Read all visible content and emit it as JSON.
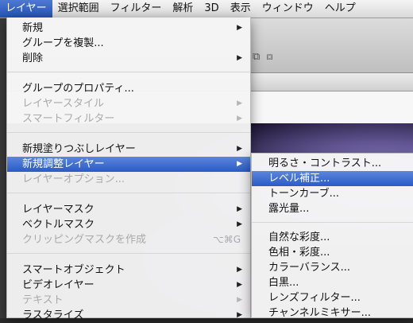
{
  "menubar": {
    "items": [
      "レイヤー",
      "選択範囲",
      "フィルター",
      "解析",
      "3D",
      "表示",
      "ウィンドウ",
      "ヘルプ"
    ]
  },
  "menu": {
    "items": [
      {
        "label": "新規",
        "arrow": "▶"
      },
      {
        "label": "グループを複製..."
      },
      {
        "label": "削除",
        "arrow": "▶"
      },
      {
        "label": "グループのプロパティ..."
      },
      {
        "label": "レイヤースタイル",
        "arrow": "▶",
        "disabled": true
      },
      {
        "label": "スマートフィルター",
        "arrow": "▶",
        "disabled": true
      },
      {
        "label": "新規塗りつぶしレイヤー",
        "arrow": "▶"
      },
      {
        "label": "新規調整レイヤー",
        "arrow": "▶",
        "highlight": true
      },
      {
        "label": "レイヤーオプション...",
        "disabled": true
      },
      {
        "label": "レイヤーマスク",
        "arrow": "▶"
      },
      {
        "label": "ベクトルマスク",
        "arrow": "▶"
      },
      {
        "label": "クリッピングマスクを作成",
        "shortcut": "⌥⌘G",
        "disabled": true
      },
      {
        "label": "スマートオブジェクト",
        "arrow": "▶"
      },
      {
        "label": "ビデオレイヤー",
        "arrow": "▶"
      },
      {
        "label": "テキスト",
        "arrow": "▶",
        "disabled": true
      },
      {
        "label": "ラスタライズ",
        "arrow": "▶"
      }
    ]
  },
  "submenu": {
    "items": [
      {
        "label": "明るさ・コントラスト..."
      },
      {
        "label": "レベル補正...",
        "highlight": true
      },
      {
        "label": "トーンカーブ..."
      },
      {
        "label": "露光量..."
      },
      {
        "label": "自然な彩度..."
      },
      {
        "label": "色相・彩度..."
      },
      {
        "label": "カラーバランス..."
      },
      {
        "label": "白黒..."
      },
      {
        "label": "レンズフィルター..."
      },
      {
        "label": "チャンネルミキサー..."
      }
    ]
  },
  "options_bar": {
    "icon_glyphs": "⧉ ⧈"
  },
  "colors": {
    "highlight": "#2a5bc6",
    "disabled_text": "#a9a9a9"
  }
}
